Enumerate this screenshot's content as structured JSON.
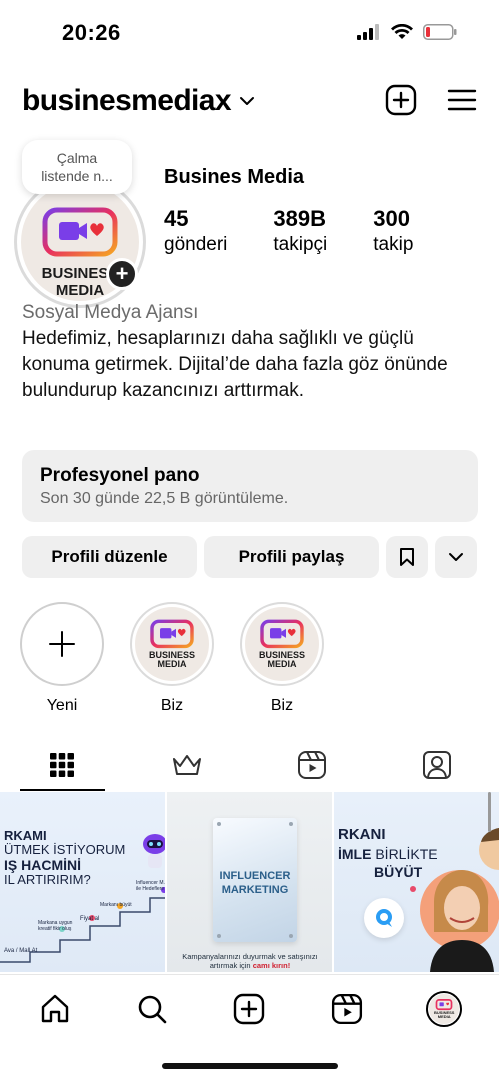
{
  "status_bar": {
    "time": "20:26"
  },
  "header": {
    "username": "businesmediax"
  },
  "profile": {
    "note": [
      "Çalma",
      "listende n..."
    ],
    "display_name": "Busines Media",
    "stats": [
      {
        "value": "45",
        "label": "gönderi"
      },
      {
        "value": "389B",
        "label": "takipçi"
      },
      {
        "value": "300",
        "label": "takip"
      }
    ],
    "category": "Sosyal Medya Ajansı",
    "bio": "Hedefimiz, hesaplarınızı daha sağlıklı ve güçlü konuma getirmek. Dijital’de daha fazla göz önünde bulundurup kazancınızı arttırmak."
  },
  "logo": {
    "line1": "BUSINESS",
    "line2": "MEDIA"
  },
  "dashboard": {
    "title": "Profesyonel pano",
    "subtitle": "Son 30 günde 22,5 B görüntüleme."
  },
  "buttons": {
    "edit": "Profili düzenle",
    "share": "Profili paylaş"
  },
  "highlights": [
    {
      "label": "Yeni"
    },
    {
      "label": "Biz"
    },
    {
      "label": "Biz"
    }
  ],
  "posts": {
    "post1": {
      "lines": [
        "RKAMI",
        "ÜTMEK İSTİYORUM",
        "IŞ HACMİNİ",
        "IL ARTIRIRIM?"
      ],
      "steps": [
        "Ava / Mall At",
        "Markana uygun kreatif fikir oluş",
        "Fiyat al",
        "Markanı büyüt",
        "Influencer M. ile Hedeflere"
      ]
    },
    "post2": {
      "sign": [
        "INFLUENCER",
        "MARKETING"
      ],
      "caption_lead": "Kampanyalarınızı duyurmak ve satışınızı artırmak için ",
      "caption_bold": "camı kırın!"
    },
    "post3": {
      "line1_bold": "RKANI",
      "line2_bold": "İMLE",
      "line2_light": " BİRLİKTE",
      "line3": "BÜYÜT"
    }
  },
  "colors": {
    "accent_purple": "#7a3ee8",
    "accent_red": "#e8303a",
    "grid_bg": "#e6eef8"
  }
}
